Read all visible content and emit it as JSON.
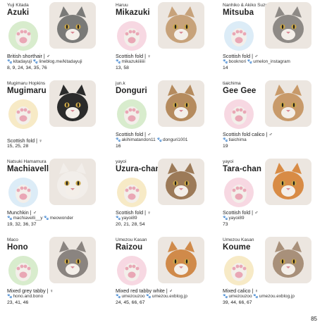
{
  "cats": [
    {
      "owner": "Yuji Kitada",
      "name": "Azuki",
      "breed": "British shorthair | ♂",
      "social": [
        {
          "icon": "paw-icon",
          "text": "kitadayuji"
        },
        {
          "icon": "paw-icon",
          "text": "lineblog.me/kitadayuji"
        }
      ],
      "pages": "8, 9, 24, 34, 35, 76",
      "paw_bg": "#d8eccd",
      "fur": "#7a7a78"
    },
    {
      "owner": "Haruu",
      "name": "Mikazuki",
      "breed": "Scottish fold | ♀",
      "social": [
        {
          "icon": "paw-icon",
          "text": "mikazukiiiiiii"
        }
      ],
      "pages": "13, 58",
      "paw_bg": "#f7d8e2",
      "fur": "#c7a27a"
    },
    {
      "owner": "Nanhiko & Akiko Suzuki",
      "name": "Mitsuba",
      "breed": "Scottish fold | ♂",
      "social": [
        {
          "icon": "paw-icon",
          "text": "booknori"
        },
        {
          "icon": "paw-icon",
          "text": "umelon_instagram"
        }
      ],
      "pages": "14",
      "paw_bg": "#dcecf7",
      "fur": "#8e8a86"
    },
    {
      "owner": "Mugimaru Hopkins",
      "name": "Mugimaru",
      "breed": "Scottish fold | ♀",
      "social": [],
      "pages": "15, 25, 28",
      "paw_bg": "#f7eac6",
      "fur": "#2b2b2b"
    },
    {
      "owner": "jun.k",
      "name": "Donguri",
      "breed": "Scottish fold | ♂",
      "social": [
        {
          "icon": "paw-icon",
          "text": "akihimatandon11"
        },
        {
          "icon": "paw-icon",
          "text": "donguri1001"
        }
      ],
      "pages": "16",
      "paw_bg": "#d8eccd",
      "fur": "#b58b5e"
    },
    {
      "owner": "tiaichima",
      "name": "Gee Gee",
      "breed": "Scottish fold calico | ♂",
      "social": [
        {
          "icon": "paw-icon",
          "text": "tiaichima"
        }
      ],
      "pages": "19",
      "paw_bg": "#f7d8e2",
      "fur": "#c89a6a"
    },
    {
      "owner": "Natsuki Hamamura",
      "name": "Machiavelli",
      "breed": "Munchkin | ♂",
      "social": [
        {
          "icon": "paw-icon",
          "text": "machiavelli__y"
        },
        {
          "icon": "paw-icon",
          "text": "meowonder"
        }
      ],
      "pages": "19, 32, 36, 37",
      "paw_bg": "#dcecf7",
      "fur": "#f2eeea"
    },
    {
      "owner": "yayoi",
      "name": "Uzura-chan",
      "breed": "Scottish fold | ♀",
      "social": [
        {
          "icon": "paw-icon",
          "text": "yayoi89"
        }
      ],
      "pages": "20, 21, 28, 54",
      "paw_bg": "#f7eac6",
      "fur": "#9c7a58"
    },
    {
      "owner": "yayoi",
      "name": "Tara-chan",
      "breed": "Scottish fold | ♂",
      "social": [
        {
          "icon": "paw-icon",
          "text": "yayoi89"
        }
      ],
      "pages": "73",
      "paw_bg": "#f7d8e2",
      "fur": "#d88b45"
    },
    {
      "owner": "Maco",
      "name": "Hono",
      "breed": "Mixed grey tabby | ♀",
      "social": [
        {
          "icon": "paw-icon",
          "text": "hono.and.bono"
        }
      ],
      "pages": "23, 41, 46",
      "paw_bg": "#d8eccd",
      "fur": "#8a8480"
    },
    {
      "owner": "Umezou Kasan",
      "name": "Raizou",
      "breed": "Mixed red tabby white | ♂",
      "social": [
        {
          "icon": "paw-icon",
          "text": "umezouzoo"
        },
        {
          "icon": "paw-icon",
          "text": "umezou.exblog.jp"
        }
      ],
      "pages": "24, 45, 66, 67",
      "paw_bg": "#f7d8e2",
      "fur": "#d08a4a"
    },
    {
      "owner": "Umezou Kasan",
      "name": "Koume",
      "breed": "Mixed calico | ♀",
      "social": [
        {
          "icon": "paw-icon",
          "text": "umezouzoo"
        },
        {
          "icon": "paw-icon",
          "text": "umezou.exblog.jp"
        }
      ],
      "pages": "39, 44, 66, 67",
      "paw_bg": "#f7eac6",
      "fur": "#a8907a"
    }
  ],
  "page_number": "85"
}
